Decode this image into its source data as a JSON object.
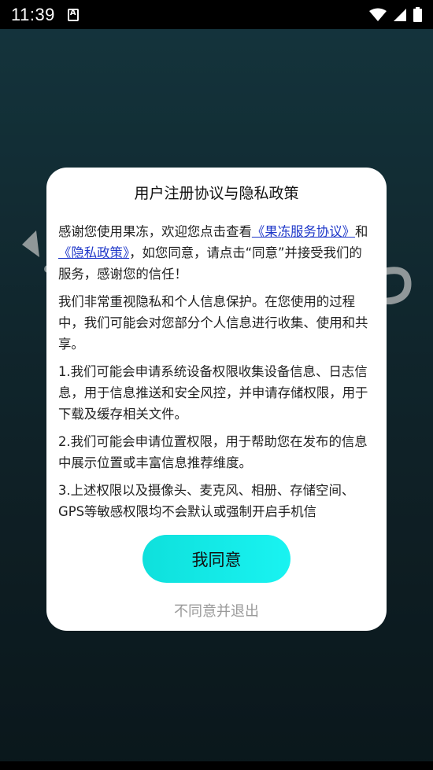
{
  "status_bar": {
    "time": "11:39",
    "icons": [
      "notification-a-icon",
      "wifi-icon",
      "signal-icon",
      "battery-icon"
    ]
  },
  "dialog": {
    "title": "用户注册协议与隐私政策",
    "p1_before": "感谢您使用果冻，欢迎您点击查看",
    "link_service": "《果冻服务协议》",
    "p1_and": "和",
    "link_privacy": "《隐私政策》",
    "p1_after": "，如您同意，请点击“同意”并接受我们的服务，感谢您的信任！",
    "p2": "我们非常重视隐私和个人信息保护。在您使用的过程中，我们可能会对您部分个人信息进行收集、使用和共享。",
    "p3": "1.我们可能会申请系统设备权限收集设备信息、日志信息，用于信息推送和安全风控，并申请存储权限，用于下载及缓存相关文件。",
    "p4": "2.我们可能会申请位置权限，用于帮助您在发布的信息中展示位置或丰富信息推荐维度。",
    "p5": "3.上述权限以及摄像头、麦克风、相册、存储空间、GPS等敏感权限均不会默认或强制开启手机信",
    "agree_label": "我同意",
    "decline_label": "不同意并退出"
  },
  "colors": {
    "accent": "#19f3f1",
    "link": "#1f38c9",
    "decline_text": "#9a9a9a",
    "background": "#16333c"
  }
}
